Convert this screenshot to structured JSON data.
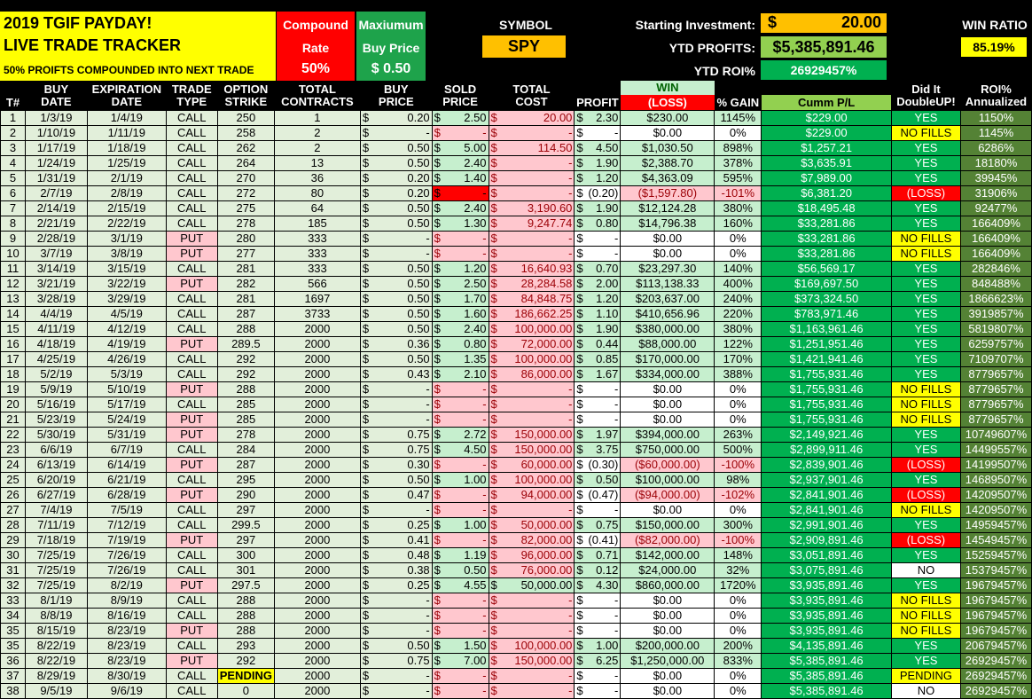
{
  "header": {
    "title_line1": "2019 TGIF PAYDAY!",
    "title_line2": "LIVE TRADE TRACKER",
    "title_line3": "50% PROIFTS COMPOUNDED INTO NEXT TRADE",
    "compound_label1": "Compound",
    "compound_label2": "Rate",
    "compound_value": "50%",
    "max_label1": "Maxiumum",
    "max_label2": "Buy Price",
    "max_value": "$  0.50",
    "symbol_label": "SYMBOL",
    "symbol_value": "SPY",
    "starting_label": "Starting Investment:",
    "starting_dollar": "$",
    "starting_value": "20.00",
    "ytd_profits_label": "YTD PROFITS:",
    "ytd_profits_value": "$5,385,891.46",
    "ytd_roi_label": "YTD ROI%",
    "ytd_roi_value": "26929457%",
    "win_ratio_label": "WIN RATIO",
    "win_ratio_value": "85.19%"
  },
  "columns": {
    "num": "T#",
    "buy_date": [
      "BUY",
      "DATE"
    ],
    "exp_date": [
      "EXPIRATION",
      "DATE"
    ],
    "trade_type": [
      "TRADE",
      "TYPE"
    ],
    "strike": [
      "OPTION",
      "STRIKE"
    ],
    "contracts": [
      "TOTAL",
      "CONTRACTS"
    ],
    "buy_price": [
      "BUY",
      "PRICE"
    ],
    "sold_price": [
      "SOLD",
      "PRICE"
    ],
    "total_cost": [
      "TOTAL",
      "COST"
    ],
    "profit": "PROFIT",
    "win": "WIN",
    "loss": "(LOSS)",
    "pct_gain": "% GAIN",
    "cumm": "Cumm P/L",
    "double": [
      "Did It",
      "DoubleUP!"
    ],
    "roi": [
      "ROI%",
      "Annualized"
    ]
  },
  "rows": [
    {
      "n": "1",
      "bd": "1/3/19",
      "ed": "1/4/19",
      "tt": "CALL",
      "st": "250",
      "ct": "1",
      "bp": "0.20",
      "sp": "2.50",
      "tc": "20.00",
      "pr": "2.30",
      "wl": "$230.00",
      "pg": "1145%",
      "cu": "$229.00",
      "du": "YES",
      "ro": "1150%"
    },
    {
      "n": "2",
      "bd": "1/10/19",
      "ed": "1/11/19",
      "tt": "CALL",
      "st": "258",
      "ct": "2",
      "bp": "-",
      "sp": "-",
      "tc": "-",
      "pr": "-",
      "wl": "$0.00",
      "pg": "0%",
      "cu": "$229.00",
      "du": "NO FILLS",
      "ro": "1145%"
    },
    {
      "n": "3",
      "bd": "1/17/19",
      "ed": "1/18/19",
      "tt": "CALL",
      "st": "262",
      "ct": "2",
      "bp": "0.50",
      "sp": "5.00",
      "tc": "114.50",
      "pr": "4.50",
      "wl": "$1,030.50",
      "pg": "898%",
      "cu": "$1,257.21",
      "du": "YES",
      "ro": "6286%"
    },
    {
      "n": "4",
      "bd": "1/24/19",
      "ed": "1/25/19",
      "tt": "CALL",
      "st": "264",
      "ct": "13",
      "bp": "0.50",
      "sp": "2.40",
      "tc": "-",
      "pr": "1.90",
      "wl": "$2,388.70",
      "pg": "378%",
      "cu": "$3,635.91",
      "du": "YES",
      "ro": "18180%"
    },
    {
      "n": "5",
      "bd": "1/31/19",
      "ed": "2/1/19",
      "tt": "CALL",
      "st": "270",
      "ct": "36",
      "bp": "0.20",
      "sp": "1.40",
      "tc": "-",
      "pr": "1.20",
      "wl": "$4,363.09",
      "pg": "595%",
      "cu": "$7,989.00",
      "du": "YES",
      "ro": "39945%"
    },
    {
      "n": "6",
      "bd": "2/7/19",
      "ed": "2/8/19",
      "tt": "CALL",
      "st": "272",
      "ct": "80",
      "bp": "0.20",
      "sp": "-",
      "tc": "-",
      "pr": "(0.20)",
      "wl": "($1,597.80)",
      "pg": "-101%",
      "cu": "$6,381.20",
      "du": "(LOSS)",
      "ro": "31906%"
    },
    {
      "n": "7",
      "bd": "2/14/19",
      "ed": "2/15/19",
      "tt": "CALL",
      "st": "275",
      "ct": "64",
      "bp": "0.50",
      "sp": "2.40",
      "tc": "3,190.60",
      "pr": "1.90",
      "wl": "$12,124.28",
      "pg": "380%",
      "cu": "$18,495.48",
      "du": "YES",
      "ro": "92477%"
    },
    {
      "n": "8",
      "bd": "2/21/19",
      "ed": "2/22/19",
      "tt": "CALL",
      "st": "278",
      "ct": "185",
      "bp": "0.50",
      "sp": "1.30",
      "tc": "9,247.74",
      "pr": "0.80",
      "wl": "$14,796.38",
      "pg": "160%",
      "cu": "$33,281.86",
      "du": "YES",
      "ro": "166409%"
    },
    {
      "n": "9",
      "bd": "2/28/19",
      "ed": "3/1/19",
      "tt": "PUT",
      "st": "280",
      "ct": "333",
      "bp": "-",
      "sp": "-",
      "tc": "-",
      "pr": "-",
      "wl": "$0.00",
      "pg": "0%",
      "cu": "$33,281.86",
      "du": "NO FILLS",
      "ro": "166409%"
    },
    {
      "n": "10",
      "bd": "3/7/19",
      "ed": "3/8/19",
      "tt": "PUT",
      "st": "277",
      "ct": "333",
      "bp": "-",
      "sp": "-",
      "tc": "-",
      "pr": "-",
      "wl": "$0.00",
      "pg": "0%",
      "cu": "$33,281.86",
      "du": "NO FILLS",
      "ro": "166409%"
    },
    {
      "n": "11",
      "bd": "3/14/19",
      "ed": "3/15/19",
      "tt": "CALL",
      "st": "281",
      "ct": "333",
      "bp": "0.50",
      "sp": "1.20",
      "tc": "16,640.93",
      "pr": "0.70",
      "wl": "$23,297.30",
      "pg": "140%",
      "cu": "$56,569.17",
      "du": "YES",
      "ro": "282846%"
    },
    {
      "n": "12",
      "bd": "3/21/19",
      "ed": "3/22/19",
      "tt": "PUT",
      "st": "282",
      "ct": "566",
      "bp": "0.50",
      "sp": "2.50",
      "tc": "28,284.58",
      "pr": "2.00",
      "wl": "$113,138.33",
      "pg": "400%",
      "cu": "$169,697.50",
      "du": "YES",
      "ro": "848488%"
    },
    {
      "n": "13",
      "bd": "3/28/19",
      "ed": "3/29/19",
      "tt": "CALL",
      "st": "281",
      "ct": "1697",
      "bp": "0.50",
      "sp": "1.70",
      "tc": "84,848.75",
      "pr": "1.20",
      "wl": "$203,637.00",
      "pg": "240%",
      "cu": "$373,324.50",
      "du": "YES",
      "ro": "1866623%"
    },
    {
      "n": "14",
      "bd": "4/4/19",
      "ed": "4/5/19",
      "tt": "CALL",
      "st": "287",
      "ct": "3733",
      "bp": "0.50",
      "sp": "1.60",
      "tc": "186,662.25",
      "pr": "1.10",
      "wl": "$410,656.96",
      "pg": "220%",
      "cu": "$783,971.46",
      "du": "YES",
      "ro": "3919857%"
    },
    {
      "n": "15",
      "bd": "4/11/19",
      "ed": "4/12/19",
      "tt": "CALL",
      "st": "288",
      "ct": "2000",
      "bp": "0.50",
      "sp": "2.40",
      "tc": "100,000.00",
      "pr": "1.90",
      "wl": "$380,000.00",
      "pg": "380%",
      "cu": "$1,163,961.46",
      "du": "YES",
      "ro": "5819807%"
    },
    {
      "n": "16",
      "bd": "4/18/19",
      "ed": "4/19/19",
      "tt": "PUT",
      "st": "289.5",
      "ct": "2000",
      "bp": "0.36",
      "sp": "0.80",
      "tc": "72,000.00",
      "pr": "0.44",
      "wl": "$88,000.00",
      "pg": "122%",
      "cu": "$1,251,951.46",
      "du": "YES",
      "ro": "6259757%"
    },
    {
      "n": "17",
      "bd": "4/25/19",
      "ed": "4/26/19",
      "tt": "CALL",
      "st": "292",
      "ct": "2000",
      "bp": "0.50",
      "sp": "1.35",
      "tc": "100,000.00",
      "pr": "0.85",
      "wl": "$170,000.00",
      "pg": "170%",
      "cu": "$1,421,941.46",
      "du": "YES",
      "ro": "7109707%"
    },
    {
      "n": "18",
      "bd": "5/2/19",
      "ed": "5/3/19",
      "tt": "CALL",
      "st": "292",
      "ct": "2000",
      "bp": "0.43",
      "sp": "2.10",
      "tc": "86,000.00",
      "pr": "1.67",
      "wl": "$334,000.00",
      "pg": "388%",
      "cu": "$1,755,931.46",
      "du": "YES",
      "ro": "8779657%"
    },
    {
      "n": "19",
      "bd": "5/9/19",
      "ed": "5/10/19",
      "tt": "PUT",
      "st": "288",
      "ct": "2000",
      "bp": "-",
      "sp": "-",
      "tc": "-",
      "pr": "-",
      "wl": "$0.00",
      "pg": "0%",
      "cu": "$1,755,931.46",
      "du": "NO FILLS",
      "ro": "8779657%"
    },
    {
      "n": "20",
      "bd": "5/16/19",
      "ed": "5/17/19",
      "tt": "CALL",
      "st": "285",
      "ct": "2000",
      "bp": "-",
      "sp": "-",
      "tc": "-",
      "pr": "-",
      "wl": "$0.00",
      "pg": "0%",
      "cu": "$1,755,931.46",
      "du": "NO FILLS",
      "ro": "8779657%"
    },
    {
      "n": "21",
      "bd": "5/23/19",
      "ed": "5/24/19",
      "tt": "PUT",
      "st": "285",
      "ct": "2000",
      "bp": "-",
      "sp": "-",
      "tc": "-",
      "pr": "-",
      "wl": "$0.00",
      "pg": "0%",
      "cu": "$1,755,931.46",
      "du": "NO FILLS",
      "ro": "8779657%"
    },
    {
      "n": "22",
      "bd": "5/30/19",
      "ed": "5/31/19",
      "tt": "PUT",
      "st": "278",
      "ct": "2000",
      "bp": "0.75",
      "sp": "2.72",
      "tc": "150,000.00",
      "pr": "1.97",
      "wl": "$394,000.00",
      "pg": "263%",
      "cu": "$2,149,921.46",
      "du": "YES",
      "ro": "10749607%"
    },
    {
      "n": "23",
      "bd": "6/6/19",
      "ed": "6/7/19",
      "tt": "CALL",
      "st": "284",
      "ct": "2000",
      "bp": "0.75",
      "sp": "4.50",
      "tc": "150,000.00",
      "pr": "3.75",
      "wl": "$750,000.00",
      "pg": "500%",
      "cu": "$2,899,911.46",
      "du": "YES",
      "ro": "14499557%"
    },
    {
      "n": "24",
      "bd": "6/13/19",
      "ed": "6/14/19",
      "tt": "PUT",
      "st": "287",
      "ct": "2000",
      "bp": "0.30",
      "sp": "-",
      "tc": "60,000.00",
      "pr": "(0.30)",
      "wl": "($60,000.00)",
      "pg": "-100%",
      "cu": "$2,839,901.46",
      "du": "(LOSS)",
      "ro": "14199507%"
    },
    {
      "n": "25",
      "bd": "6/20/19",
      "ed": "6/21/19",
      "tt": "CALL",
      "st": "295",
      "ct": "2000",
      "bp": "0.50",
      "sp": "1.00",
      "tc": "100,000.00",
      "pr": "0.50",
      "wl": "$100,000.00",
      "pg": "98%",
      "cu": "$2,937,901.46",
      "du": "YES",
      "ro": "14689507%"
    },
    {
      "n": "26",
      "bd": "6/27/19",
      "ed": "6/28/19",
      "tt": "PUT",
      "st": "290",
      "ct": "2000",
      "bp": "0.47",
      "sp": "-",
      "tc": "94,000.00",
      "pr": "(0.47)",
      "wl": "($94,000.00)",
      "pg": "-102%",
      "cu": "$2,841,901.46",
      "du": "(LOSS)",
      "ro": "14209507%"
    },
    {
      "n": "27",
      "bd": "7/4/19",
      "ed": "7/5/19",
      "tt": "CALL",
      "st": "297",
      "ct": "2000",
      "bp": "-",
      "sp": "-",
      "tc": "-",
      "pr": "-",
      "wl": "$0.00",
      "pg": "0%",
      "cu": "$2,841,901.46",
      "du": "NO FILLS",
      "ro": "14209507%"
    },
    {
      "n": "28",
      "bd": "7/11/19",
      "ed": "7/12/19",
      "tt": "CALL",
      "st": "299.5",
      "ct": "2000",
      "bp": "0.25",
      "sp": "1.00",
      "tc": "50,000.00",
      "pr": "0.75",
      "wl": "$150,000.00",
      "pg": "300%",
      "cu": "$2,991,901.46",
      "du": "YES",
      "ro": "14959457%"
    },
    {
      "n": "29",
      "bd": "7/18/19",
      "ed": "7/19/19",
      "tt": "PUT",
      "st": "297",
      "ct": "2000",
      "bp": "0.41",
      "sp": "-",
      "tc": "82,000.00",
      "pr": "(0.41)",
      "wl": "($82,000.00)",
      "pg": "-100%",
      "cu": "$2,909,891.46",
      "du": "(LOSS)",
      "ro": "14549457%"
    },
    {
      "n": "30",
      "bd": "7/25/19",
      "ed": "7/26/19",
      "tt": "CALL",
      "st": "300",
      "ct": "2000",
      "bp": "0.48",
      "sp": "1.19",
      "tc": "96,000.00",
      "pr": "0.71",
      "wl": "$142,000.00",
      "pg": "148%",
      "cu": "$3,051,891.46",
      "du": "YES",
      "ro": "15259457%"
    },
    {
      "n": "31",
      "bd": "7/25/19",
      "ed": "7/26/19",
      "tt": "CALL",
      "st": "301",
      "ct": "2000",
      "bp": "0.38",
      "sp": "0.50",
      "tc": "76,000.00",
      "pr": "0.12",
      "wl": "$24,000.00",
      "pg": "32%",
      "cu": "$3,075,891.46",
      "du": "NO",
      "ro": "15379457%"
    },
    {
      "n": "32",
      "bd": "7/25/19",
      "ed": "8/2/19",
      "tt": "PUT",
      "st": "297.5",
      "ct": "2000",
      "bp": "0.25",
      "sp": "4.55",
      "tc": "50,000.00",
      "pr": "4.30",
      "wl": "$860,000.00",
      "pg": "1720%",
      "cu": "$3,935,891.46",
      "du": "YES",
      "ro": "19679457%"
    },
    {
      "n": "33",
      "bd": "8/1/19",
      "ed": "8/9/19",
      "tt": "CALL",
      "st": "288",
      "ct": "2000",
      "bp": "-",
      "sp": "-",
      "tc": "-",
      "pr": "-",
      "wl": "$0.00",
      "pg": "0%",
      "cu": "$3,935,891.46",
      "du": "NO FILLS",
      "ro": "19679457%"
    },
    {
      "n": "34",
      "bd": "8/8/19",
      "ed": "8/16/19",
      "tt": "CALL",
      "st": "288",
      "ct": "2000",
      "bp": "-",
      "sp": "-",
      "tc": "-",
      "pr": "-",
      "wl": "$0.00",
      "pg": "0%",
      "cu": "$3,935,891.46",
      "du": "NO FILLS",
      "ro": "19679457%"
    },
    {
      "n": "35",
      "bd": "8/15/19",
      "ed": "8/23/19",
      "tt": "PUT",
      "st": "288",
      "ct": "2000",
      "bp": "-",
      "sp": "-",
      "tc": "-",
      "pr": "-",
      "wl": "$0.00",
      "pg": "0%",
      "cu": "$3,935,891.46",
      "du": "NO FILLS",
      "ro": "19679457%"
    },
    {
      "n": "35",
      "bd": "8/22/19",
      "ed": "8/23/19",
      "tt": "CALL",
      "st": "293",
      "ct": "2000",
      "bp": "0.50",
      "sp": "1.50",
      "tc": "100,000.00",
      "pr": "1.00",
      "wl": "$200,000.00",
      "pg": "200%",
      "cu": "$4,135,891.46",
      "du": "YES",
      "ro": "20679457%"
    },
    {
      "n": "36",
      "bd": "8/22/19",
      "ed": "8/23/19",
      "tt": "PUT",
      "st": "292",
      "ct": "2000",
      "bp": "0.75",
      "sp": "7.00",
      "tc": "150,000.00",
      "pr": "6.25",
      "wl": "$1,250,000.00",
      "pg": "833%",
      "cu": "$5,385,891.46",
      "du": "YES",
      "ro": "26929457%"
    },
    {
      "n": "37",
      "bd": "8/29/19",
      "ed": "8/30/19",
      "tt": "CALL",
      "st": "PENDING",
      "ct": "2000",
      "bp": "-",
      "sp": "-",
      "tc": "-",
      "pr": "-",
      "wl": "$0.00",
      "pg": "0%",
      "cu": "$5,385,891.46",
      "du": "PENDING",
      "ro": "26929457%"
    },
    {
      "n": "38",
      "bd": "9/5/19",
      "ed": "9/6/19",
      "tt": "CALL",
      "st": "0",
      "ct": "2000",
      "bp": "-",
      "sp": "-",
      "tc": "-",
      "pr": "-",
      "wl": "$0.00",
      "pg": "0%",
      "cu": "$5,385,891.46",
      "du": "NO",
      "ro": "26929457%"
    }
  ]
}
